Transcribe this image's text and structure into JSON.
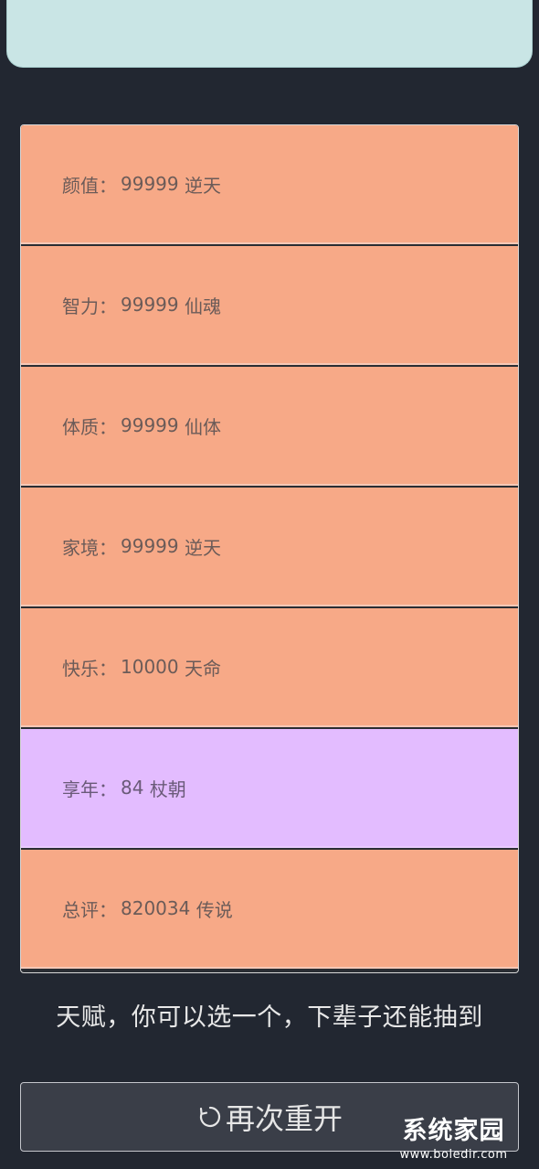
{
  "stats": [
    {
      "label": "颜值",
      "value": "99999",
      "grade": "逆天",
      "highlight": false
    },
    {
      "label": "智力",
      "value": "99999",
      "grade": "仙魂",
      "highlight": false
    },
    {
      "label": "体质",
      "value": "99999",
      "grade": "仙体",
      "highlight": false
    },
    {
      "label": "家境",
      "value": "99999",
      "grade": "逆天",
      "highlight": false
    },
    {
      "label": "快乐",
      "value": "10000",
      "grade": "天命",
      "highlight": false
    },
    {
      "label": "享年",
      "value": "84",
      "grade": "杖朝",
      "highlight": true
    },
    {
      "label": "总评",
      "value": "820034",
      "grade": "传说",
      "highlight": false
    }
  ],
  "separator": "：",
  "talent_hint": "天赋，你可以选一个，下辈子还能抽到",
  "restart_button": {
    "label": "再次重开",
    "icon": "refresh-icon"
  },
  "watermark": {
    "name": "系统家园",
    "url": "www.boledir.com"
  },
  "colors": {
    "background": "#222731",
    "stat_row": "#f7a987",
    "stat_row_highlight": "#e3bcff",
    "top_banner": "#c9e5e5"
  }
}
